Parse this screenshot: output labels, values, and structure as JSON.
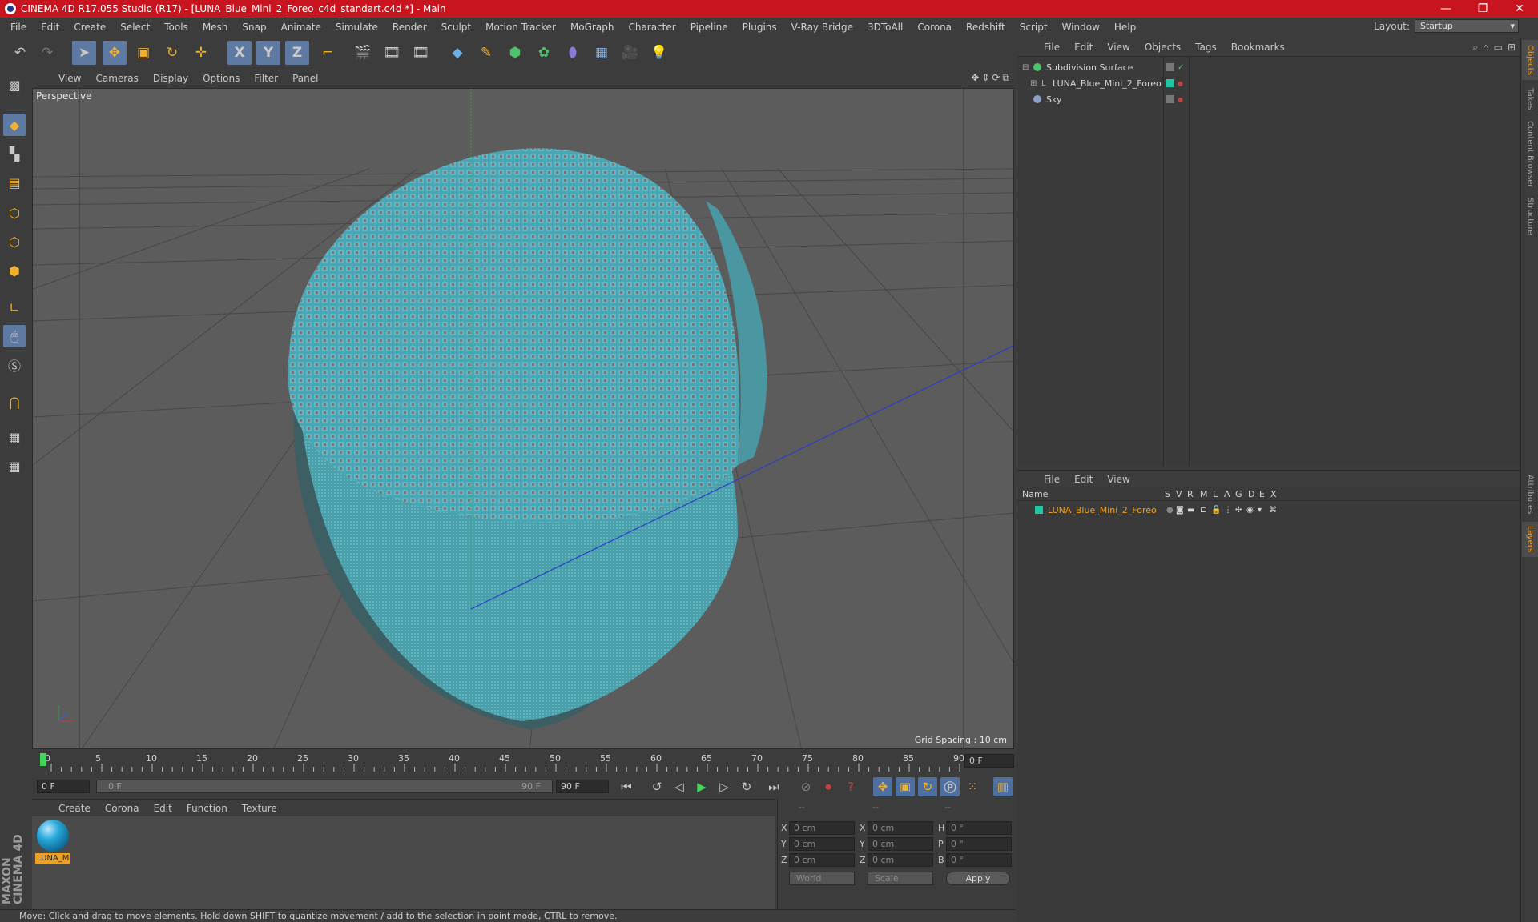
{
  "window": {
    "title": "CINEMA 4D R17.055 Studio (R17) - [LUNA_Blue_Mini_2_Foreo_c4d_standart.c4d *] - Main"
  },
  "menubar": [
    "File",
    "Edit",
    "Create",
    "Select",
    "Tools",
    "Mesh",
    "Snap",
    "Animate",
    "Simulate",
    "Render",
    "Sculpt",
    "Motion Tracker",
    "MoGraph",
    "Character",
    "Pipeline",
    "Plugins",
    "V-Ray Bridge",
    "3DToAll",
    "Corona",
    "Redshift",
    "Script",
    "Window",
    "Help"
  ],
  "layout": {
    "label": "Layout:",
    "value": "Startup"
  },
  "toolbar": {
    "axis_x": "X",
    "axis_y": "Y",
    "axis_z": "Z"
  },
  "viewport": {
    "menu": [
      "View",
      "Cameras",
      "Display",
      "Options",
      "Filter",
      "Panel"
    ],
    "label": "Perspective",
    "grid_spacing": "Grid Spacing : 10 cm"
  },
  "timeline": {
    "ticks": [
      "0",
      "5",
      "10",
      "15",
      "20",
      "25",
      "30",
      "35",
      "40",
      "45",
      "50",
      "55",
      "60",
      "65",
      "70",
      "75",
      "80",
      "85",
      "90"
    ],
    "current_frame": "0 F"
  },
  "transport": {
    "start_field": "0 F",
    "range_start": "0 F",
    "range_end": "90 F",
    "end_field": "90 F"
  },
  "material_manager": {
    "menu": [
      "Create",
      "Corona",
      "Edit",
      "Function",
      "Texture"
    ],
    "materials": [
      {
        "name": "LUNA_M"
      }
    ]
  },
  "coordinates": {
    "header": [
      "--",
      "--",
      "--"
    ],
    "rows": [
      {
        "axis": "X",
        "pos": "0 cm",
        "axis2": "X",
        "size": "0 cm",
        "rot_label": "H",
        "rot": "0 °"
      },
      {
        "axis": "Y",
        "pos": "0 cm",
        "axis2": "Y",
        "size": "0 cm",
        "rot_label": "P",
        "rot": "0 °"
      },
      {
        "axis": "Z",
        "pos": "0 cm",
        "axis2": "Z",
        "size": "0 cm",
        "rot_label": "B",
        "rot": "0 °"
      }
    ],
    "space": "World",
    "mode": "Scale",
    "apply_label": "Apply"
  },
  "status": "Move: Click and drag to move elements. Hold down SHIFT to quantize movement / add to the selection in point mode, CTRL to remove.",
  "object_manager": {
    "menu": [
      "File",
      "Edit",
      "View",
      "Objects",
      "Tags",
      "Bookmarks"
    ],
    "objects": [
      {
        "name": "Subdivision Surface",
        "color": "#4fc36b"
      },
      {
        "name": "LUNA_Blue_Mini_2_Foreo",
        "color": "#1fc7a6"
      },
      {
        "name": "Sky",
        "color": "#8aa0c8"
      }
    ]
  },
  "layer_manager": {
    "menu": [
      "File",
      "Edit",
      "View"
    ],
    "columns": [
      "Name",
      "S",
      "V",
      "R",
      "M",
      "L",
      "A",
      "G",
      "D",
      "E",
      "X"
    ],
    "layers": [
      {
        "name": "LUNA_Blue_Mini_2_Foreo",
        "color": "#1fc7a6"
      }
    ]
  },
  "side_tabs": [
    "Objects",
    "Takes",
    "Content Browser",
    "Structure",
    "Attributes",
    "Layers"
  ],
  "branding": "MAXON CINEMA 4D",
  "colors": {
    "accent_title": "#c8141e",
    "selected_tool": "#5e7aa3",
    "model": "#4aa6b4",
    "layer_name": "#f0a020"
  }
}
